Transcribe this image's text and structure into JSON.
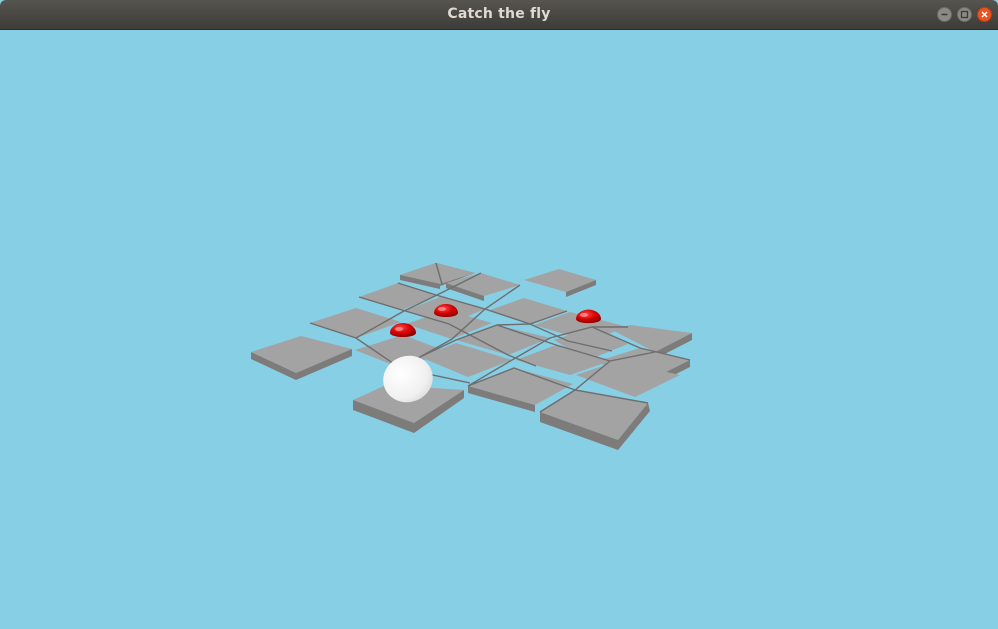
{
  "window": {
    "title": "Catch the fly",
    "controls": [
      "minimize",
      "maximize",
      "close"
    ]
  },
  "colors": {
    "sky": "#87cfe4",
    "tile_top": "#a3a3a3",
    "tile_side": "#7e7b7b",
    "fly": "#d40000",
    "ball": "#f2f2f2"
  },
  "icons": {
    "minimize": "minimize-icon",
    "maximize": "maximize-icon",
    "close": "close-icon"
  }
}
